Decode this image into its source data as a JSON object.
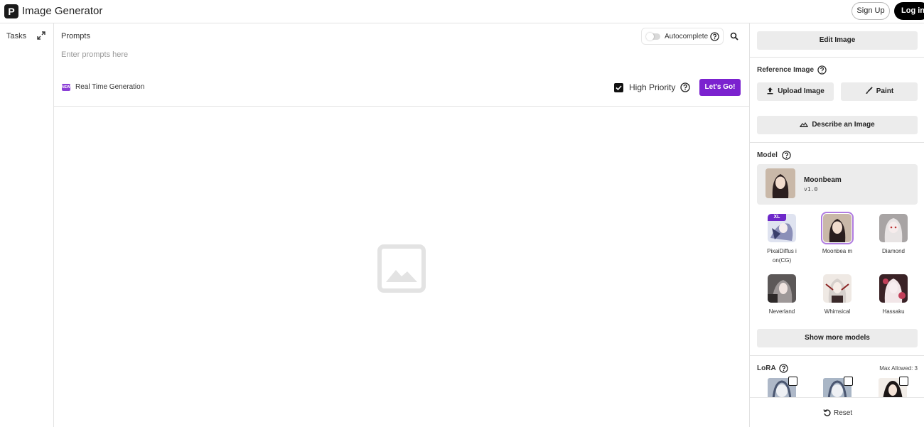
{
  "app": {
    "logo_letter": "P",
    "title": "Image Generator"
  },
  "auth": {
    "signup_label": "Sign Up",
    "login_label": "Log in"
  },
  "tasks": {
    "label": "Tasks"
  },
  "prompts": {
    "label": "Prompts",
    "placeholder": "Enter prompts here",
    "autocomplete_label": "Autocomplete",
    "autocomplete_on": false,
    "realtime_badge": "NEW",
    "realtime_label": "Real Time Generation",
    "high_priority_label": "High Priority",
    "high_priority_checked": true,
    "submit_label": "Let's Go!"
  },
  "panel": {
    "edit_image_label": "Edit Image",
    "reference_label": "Reference Image",
    "upload_label": "Upload Image",
    "paint_label": "Paint",
    "describe_label": "Describe an Image",
    "model_label": "Model",
    "selected_model": {
      "name": "Moonbeam",
      "version": "v1.0"
    },
    "models": [
      {
        "name": "PixaiDiffus ion(CG)",
        "badge": "XL",
        "selected": false
      },
      {
        "name": "Moonbea m",
        "badge": "",
        "selected": true
      },
      {
        "name": "Diamond",
        "badge": "",
        "selected": false
      },
      {
        "name": "Neverland",
        "badge": "",
        "selected": false
      },
      {
        "name": "Whimsical",
        "badge": "",
        "selected": false
      },
      {
        "name": "Hassaku",
        "badge": "",
        "selected": false
      }
    ],
    "show_more_label": "Show more models",
    "lora_label": "LoRA",
    "lora_max": "Max Allowed: 3",
    "reset_label": "Reset"
  },
  "colors": {
    "accent": "#7b22cf",
    "badge": "#6d28c9",
    "button_bg": "#ececec"
  }
}
